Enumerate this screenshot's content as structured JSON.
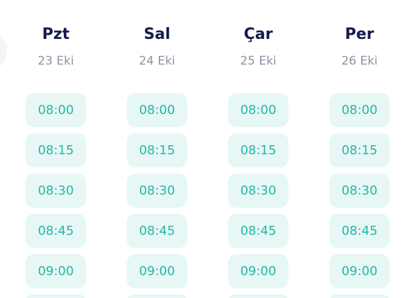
{
  "days": [
    {
      "name": "Pzt",
      "date": "23 Eki",
      "slots": [
        "08:00",
        "08:15",
        "08:30",
        "08:45",
        "09:00"
      ]
    },
    {
      "name": "Sal",
      "date": "24 Eki",
      "slots": [
        "08:00",
        "08:15",
        "08:30",
        "08:45",
        "09:00"
      ]
    },
    {
      "name": "Çar",
      "date": "25 Eki",
      "slots": [
        "08:00",
        "08:15",
        "08:30",
        "08:45",
        "09:00"
      ]
    },
    {
      "name": "Per",
      "date": "26 Eki",
      "slots": [
        "08:00",
        "08:15",
        "08:30",
        "08:45",
        "09:00"
      ]
    }
  ],
  "colors": {
    "day_name": "#141b4d",
    "date": "#8d92a3",
    "slot_bg": "#e6f7f5",
    "slot_text": "#29b5a7"
  }
}
